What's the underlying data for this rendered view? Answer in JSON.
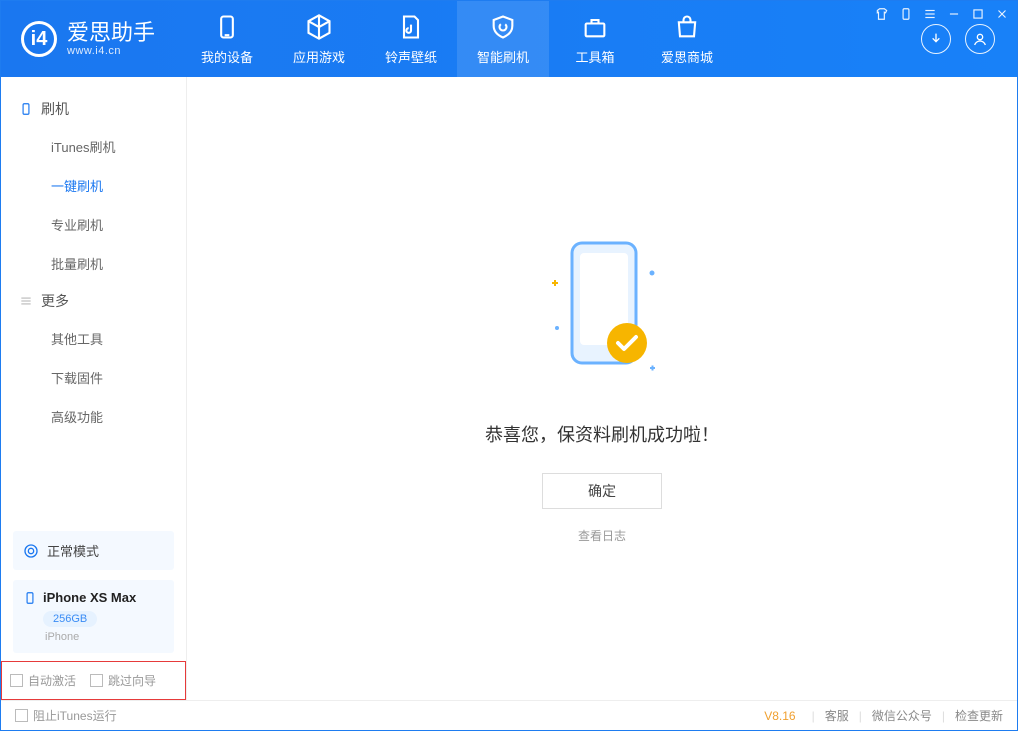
{
  "app": {
    "name": "爱思助手",
    "domain": "www.i4.cn"
  },
  "nav": [
    {
      "label": "我的设备"
    },
    {
      "label": "应用游戏"
    },
    {
      "label": "铃声壁纸"
    },
    {
      "label": "智能刷机",
      "active": true
    },
    {
      "label": "工具箱"
    },
    {
      "label": "爱思商城"
    }
  ],
  "sidebar": {
    "section1": "刷机",
    "items1": [
      "iTunes刷机",
      "一键刷机",
      "专业刷机",
      "批量刷机"
    ],
    "section2": "更多",
    "items2": [
      "其他工具",
      "下载固件",
      "高级功能"
    ],
    "mode": "正常模式",
    "device": {
      "name": "iPhone XS Max",
      "storage": "256GB",
      "type": "iPhone"
    },
    "options": {
      "auto_activate": "自动激活",
      "skip_guide": "跳过向导"
    }
  },
  "main": {
    "success": "恭喜您，保资料刷机成功啦！",
    "ok": "确定",
    "log_link": "查看日志"
  },
  "statusbar": {
    "block_itunes": "阻止iTunes运行",
    "version": "V8.16",
    "links": [
      "客服",
      "微信公众号",
      "检查更新"
    ]
  }
}
